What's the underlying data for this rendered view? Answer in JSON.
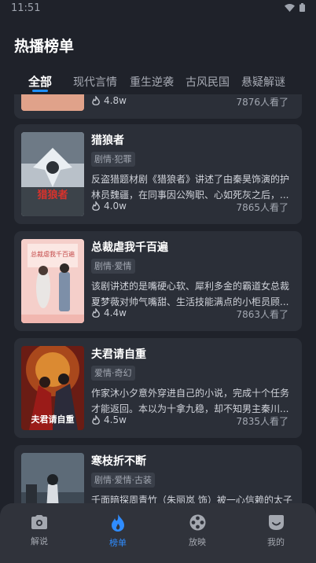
{
  "status": {
    "time": "11:51"
  },
  "page": {
    "title": "热播榜单"
  },
  "tabs": [
    {
      "label": "全部",
      "active": true
    },
    {
      "label": "现代言情",
      "active": false
    },
    {
      "label": "重生逆袭",
      "active": false
    },
    {
      "label": "古风民国",
      "active": false
    },
    {
      "label": "悬疑解谜",
      "active": false
    }
  ],
  "cards": [
    {
      "rating": "4.8w",
      "views": "7876人看了"
    },
    {
      "title": "猎狼者",
      "tag": "剧情·犯罪",
      "description": "反盗猎题材剧《猎狼者》讲述了由秦昊饰演的护林员魏疆，在同事因公殉职、心如死灰之后，...",
      "rating": "4.0w",
      "views": "7865人看了",
      "poster_text": "猎狼者"
    },
    {
      "title": "总裁虐我千百遍",
      "tag": "剧情·爱情",
      "description": "该剧讲述的是嘴硬心软、犀利多金的霸道女总裁夏梦薇对帅气嘴甜、生活技能满点的小柜员顾...",
      "rating": "4.4w",
      "views": "7863人看了",
      "poster_text": "总裁虐我千百遍"
    },
    {
      "title": "夫君请自重",
      "tag": "爱情·奇幻",
      "description": "作家沐小夕意外穿进自己的小说，完成十个任务才能返回。本以为十拿九稳，却不知男主秦川...",
      "rating": "4.5w",
      "views": "7835人看了",
      "poster_text": "夫君请自重"
    },
    {
      "title": "寒枝折不断",
      "tag": "剧情·爱情·古装",
      "description": "千面暗探周青竹（朱丽岚 饰）被一心信赖的太子",
      "rating": "",
      "views": ""
    }
  ],
  "nav": [
    {
      "label": "解说",
      "icon": "camera-icon",
      "active": false
    },
    {
      "label": "榜单",
      "icon": "flame-icon",
      "active": true
    },
    {
      "label": "放映",
      "icon": "film-reel-icon",
      "active": false
    },
    {
      "label": "我的",
      "icon": "smile-icon",
      "active": false
    }
  ],
  "colors": {
    "accent": "#2f8cff",
    "background": "#1f222a",
    "card": "#2b2f38"
  }
}
